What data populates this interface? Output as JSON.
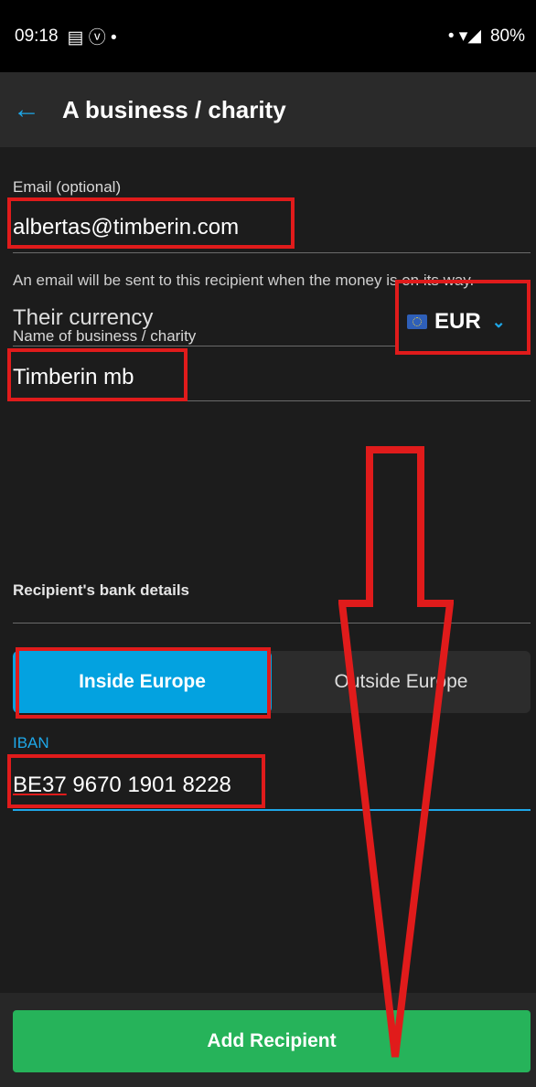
{
  "status_bar": {
    "time": "09:18",
    "left_icons": "▤ ⓥ •",
    "right_icons": "• ▾◢",
    "battery": "80%"
  },
  "app_bar": {
    "title": "A business / charity",
    "back_icon": "arrow-left-icon"
  },
  "email": {
    "label": "Email (optional)",
    "value": "albertas@timberin.com",
    "helper": "An email will be sent to this recipient when the money is on its way."
  },
  "name": {
    "label": "Name of business / charity",
    "value": "Timberin mb"
  },
  "currency": {
    "label": "Their currency",
    "code": "EUR",
    "flag_icon": "eu-flag-icon"
  },
  "bank_details": {
    "title": "Recipient's bank details",
    "tabs": [
      "Inside Europe",
      "Outside Europe"
    ],
    "selected_tab": "Inside Europe"
  },
  "iban": {
    "label": "IBAN",
    "value_prefix": "BE37",
    "value_rest": " 9670 1901 8228"
  },
  "footer": {
    "add_button": "Add Recipient"
  },
  "colors": {
    "accent": "#1ea7e8",
    "button": "#26b35a",
    "annotation": "#e01b1b"
  }
}
